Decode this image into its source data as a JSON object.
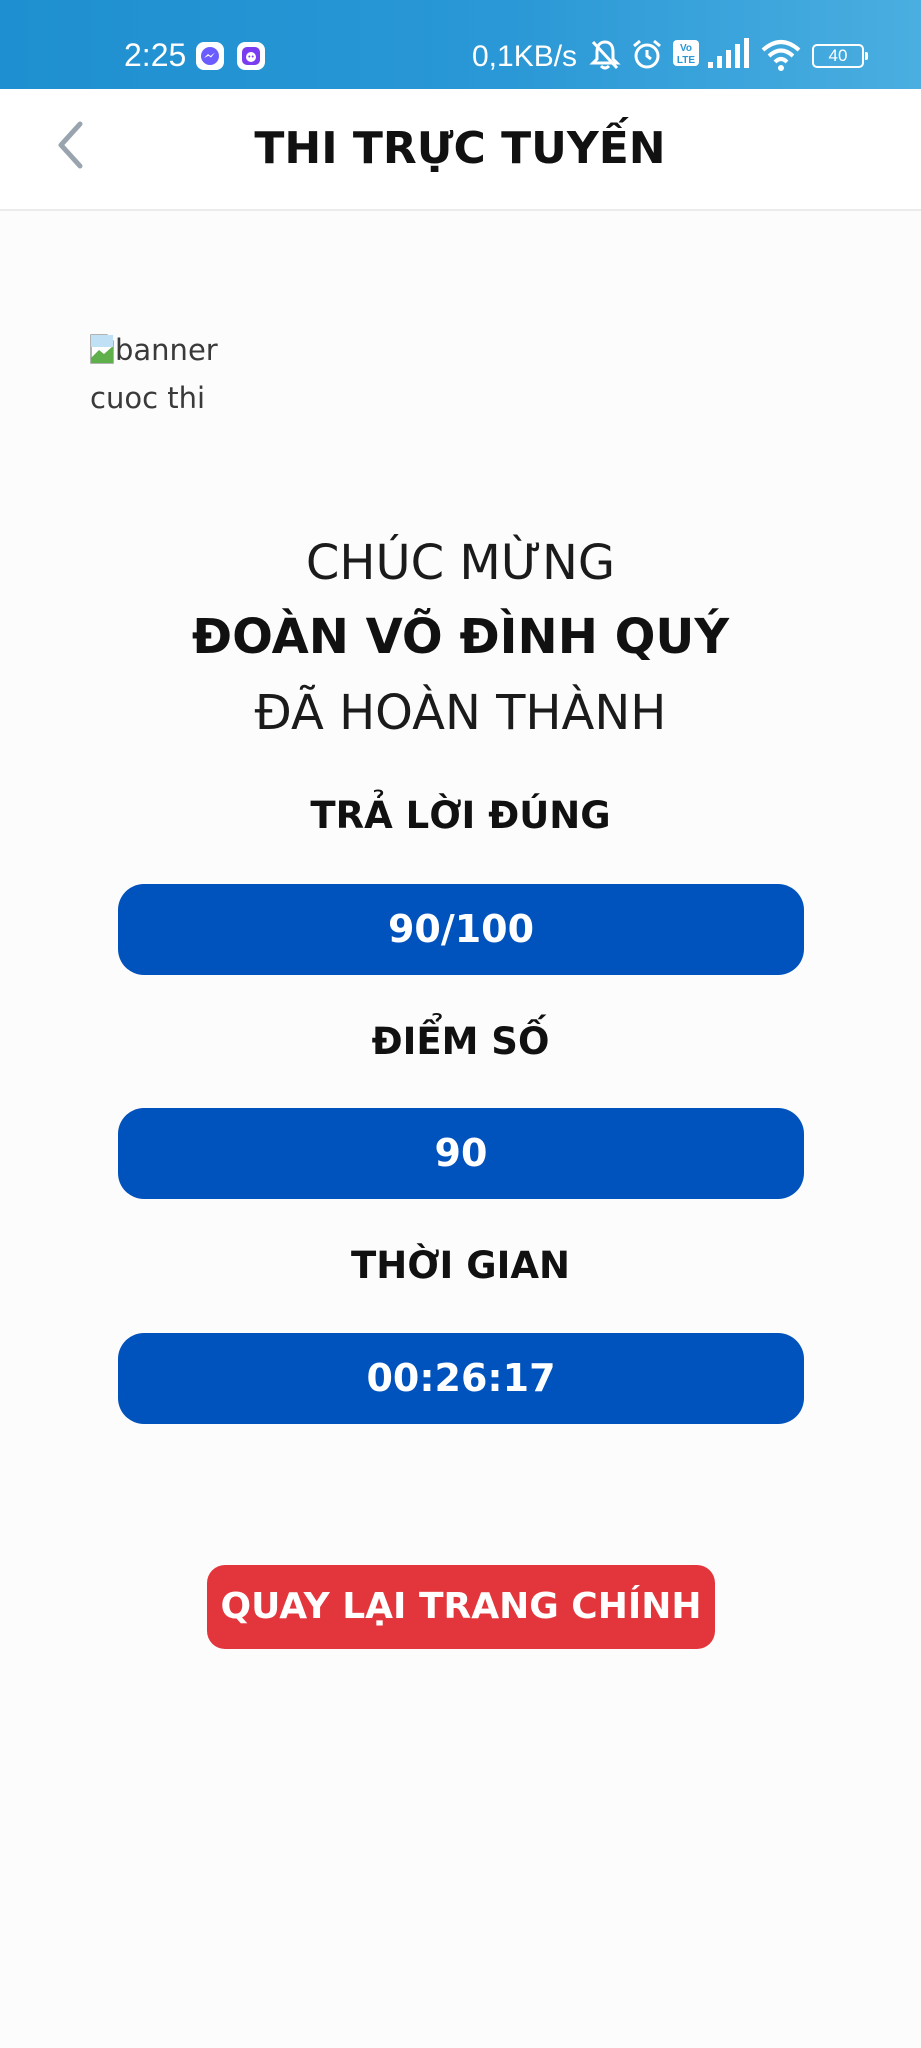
{
  "status_bar": {
    "time": "2:25",
    "network_speed": "0,1KB/s",
    "battery_level": "40",
    "icons": [
      "messenger-icon",
      "app-notification-icon",
      "bell-muted-icon",
      "alarm-icon",
      "volte-icon",
      "signal-icon",
      "wifi-icon",
      "battery-icon"
    ]
  },
  "header": {
    "title": "THI TRỰC TUYẾN",
    "back_icon": "chevron-left-icon"
  },
  "banner": {
    "alt_text": "banner cuoc thi"
  },
  "result": {
    "congrats_label": "CHÚC MỪNG",
    "participant_name": "ĐOÀN VÕ ĐÌNH QUÝ",
    "completed_label": "ĐÃ HOÀN THÀNH",
    "correct_answers_label": "TRẢ LỜI ĐÚNG",
    "correct_answers_value": "90/100",
    "score_label": "ĐIỂM SỐ",
    "score_value": "90",
    "time_label": "THỜI GIAN",
    "time_value": "00:26:17"
  },
  "actions": {
    "home_button_label": "QUAY LẠI TRANG CHÍNH"
  },
  "colors": {
    "status_bar": "#2a98d6",
    "result_pill": "#0052bd",
    "home_button": "#e3363c",
    "back_arrow": "#9aa4ae"
  }
}
